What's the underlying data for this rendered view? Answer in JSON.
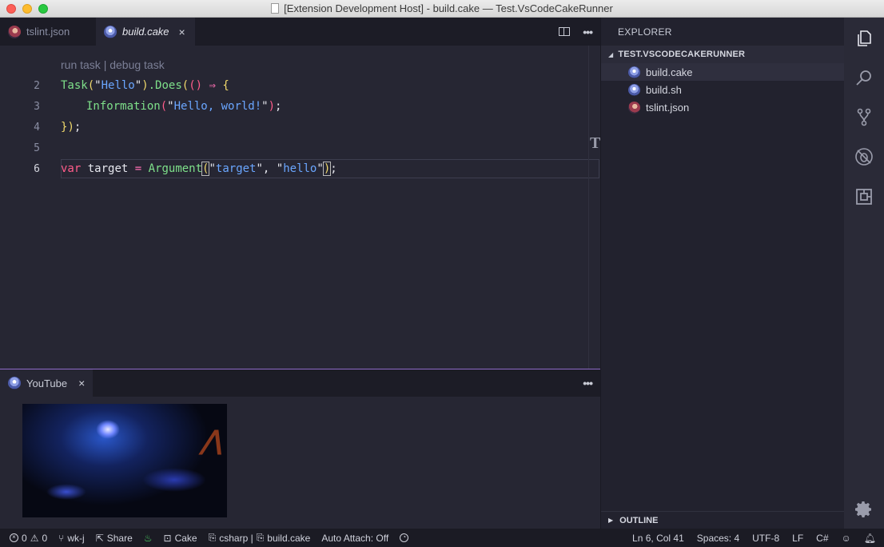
{
  "window": {
    "title": "[Extension Development Host] - build.cake — Test.VsCodeCakeRunner"
  },
  "tabs": [
    {
      "label": "tslint.json",
      "icon": "avatar-file-icon"
    },
    {
      "label": "build.cake",
      "icon": "cake-file-icon",
      "close": "×"
    }
  ],
  "editor": {
    "codelens": "run task | debug task",
    "line_numbers": [
      "2",
      "3",
      "4",
      "5",
      "6"
    ],
    "lines": {
      "l2": {
        "t1": "Task",
        "t2": "(",
        "t3": "\"",
        "t4": "Hello",
        "t5": "\"",
        "t6": ")",
        "t7": ".Does",
        "t8": "(",
        "t9": "()",
        "t10": " ⇒ ",
        "t11": "{"
      },
      "l3": {
        "t1": "Information",
        "t2": "(",
        "t3": "\"",
        "t4": "Hello, world!",
        "t5": "\"",
        "t6": ")",
        "t7": ";"
      },
      "l4": {
        "t1": "}",
        "t2": ")",
        "t3": ";"
      },
      "l6": {
        "t1": "var",
        "t2": " target ",
        "t3": "=",
        "t4": " Argument",
        "t5": "(",
        "t6": "\"",
        "t7": "target",
        "t8": "\"",
        "t9": ", ",
        "t10": "\"",
        "t11": "hello",
        "t12": "\"",
        "t13": ")",
        "t14": ";"
      }
    },
    "minimap_glyph": "T"
  },
  "panel": {
    "tab_label": "YouTube",
    "close": "×"
  },
  "sidebar": {
    "header": "EXPLORER",
    "section": "TEST.VSCODECAKERUNNER",
    "files": [
      {
        "label": "build.cake",
        "icon": "cake-file-icon"
      },
      {
        "label": "build.sh",
        "icon": "cake-file-icon"
      },
      {
        "label": "tslint.json",
        "icon": "avatar-file-icon"
      }
    ],
    "outline": "OUTLINE"
  },
  "statusbar": {
    "errors": "0",
    "warnings": "0",
    "branch": "wk-j",
    "share": "Share",
    "terminal": "Cake",
    "language_context": "csharp | ",
    "file": "build.cake",
    "auto_attach": "Auto Attach: Off",
    "position": "Ln 6, Col 41",
    "spaces": "Spaces: 4",
    "encoding": "UTF-8",
    "eol": "LF",
    "language": "C#"
  },
  "colors": {
    "accent": "#8e6ac9",
    "string": "#6aa6ff",
    "function": "#7ee08a",
    "keyword": "#ff5c8a"
  }
}
